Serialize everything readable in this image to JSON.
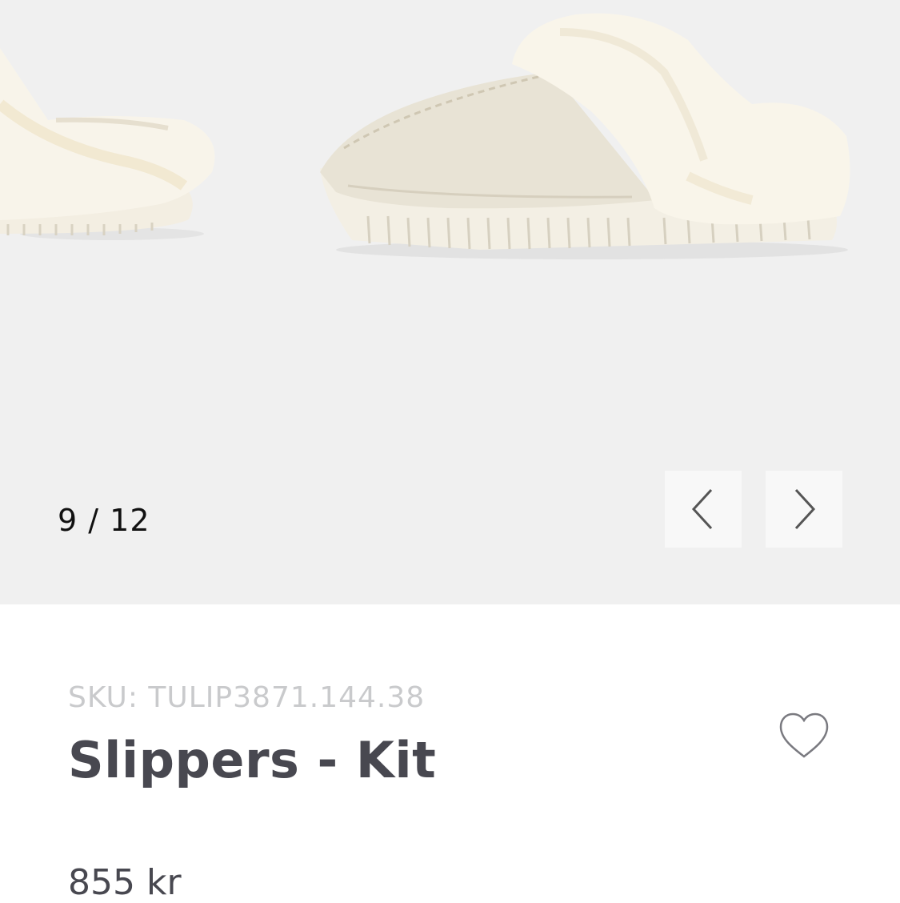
{
  "gallery": {
    "counter": "9 / 12",
    "current_index": 9,
    "total_images": 12,
    "prev_icon": "chevron-left-icon",
    "next_icon": "chevron-right-icon",
    "background_color": "#f0f0f0"
  },
  "product": {
    "sku": "SKU: TULIP3871.144.38",
    "title": "Slippers - Kit",
    "price": "855 kr",
    "wishlist_icon": "heart-outline-icon"
  },
  "colors": {
    "title": "#484850",
    "sku": "#c9cacc",
    "slipper_fur": "#f7f3e8",
    "slipper_suede": "#e8e3d6"
  }
}
